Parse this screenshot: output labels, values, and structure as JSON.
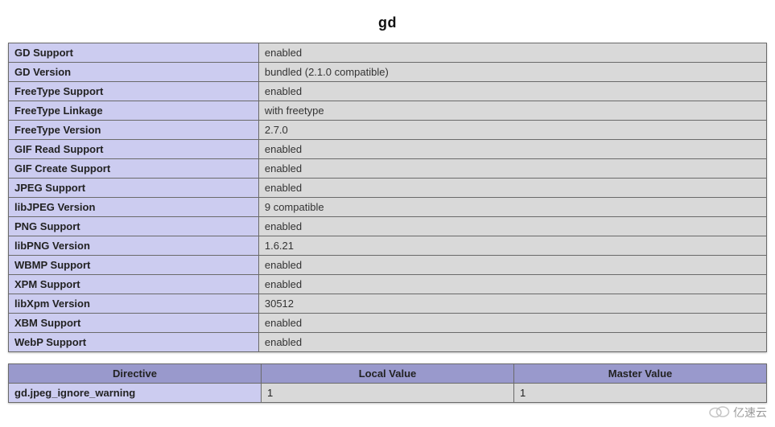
{
  "section_title": "gd",
  "info_rows": [
    {
      "label": "GD Support",
      "value": "enabled"
    },
    {
      "label": "GD Version",
      "value": "bundled (2.1.0 compatible)"
    },
    {
      "label": "FreeType Support",
      "value": "enabled"
    },
    {
      "label": "FreeType Linkage",
      "value": "with freetype"
    },
    {
      "label": "FreeType Version",
      "value": "2.7.0"
    },
    {
      "label": "GIF Read Support",
      "value": "enabled"
    },
    {
      "label": "GIF Create Support",
      "value": "enabled"
    },
    {
      "label": "JPEG Support",
      "value": "enabled"
    },
    {
      "label": "libJPEG Version",
      "value": "9 compatible"
    },
    {
      "label": "PNG Support",
      "value": "enabled"
    },
    {
      "label": "libPNG Version",
      "value": "1.6.21"
    },
    {
      "label": "WBMP Support",
      "value": "enabled"
    },
    {
      "label": "XPM Support",
      "value": "enabled"
    },
    {
      "label": "libXpm Version",
      "value": "30512"
    },
    {
      "label": "XBM Support",
      "value": "enabled"
    },
    {
      "label": "WebP Support",
      "value": "enabled"
    }
  ],
  "directives": {
    "headers": {
      "name": "Directive",
      "local": "Local Value",
      "master": "Master Value"
    },
    "rows": [
      {
        "name": "gd.jpeg_ignore_warning",
        "local": "1",
        "master": "1"
      }
    ]
  },
  "watermark": {
    "text": "亿速云"
  }
}
